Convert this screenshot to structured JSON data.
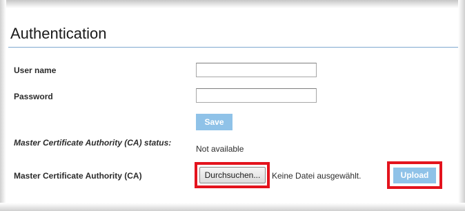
{
  "section": {
    "title": "Authentication"
  },
  "fields": {
    "username_label": "User name",
    "username_value": "",
    "password_label": "Password",
    "password_value": ""
  },
  "buttons": {
    "save_label": "Save",
    "browse_label": "Durchsuchen...",
    "upload_label": "Upload"
  },
  "ca_status": {
    "label": "Master Certificate Authority (CA) status:",
    "value": "Not available"
  },
  "ca_upload": {
    "label": "Master Certificate Authority (CA)",
    "file_status": "Keine Datei ausgewählt."
  },
  "colors": {
    "button_blue": "#8fc2e8",
    "highlight_red": "#e3131d",
    "divider_blue": "#7fa9cf"
  }
}
